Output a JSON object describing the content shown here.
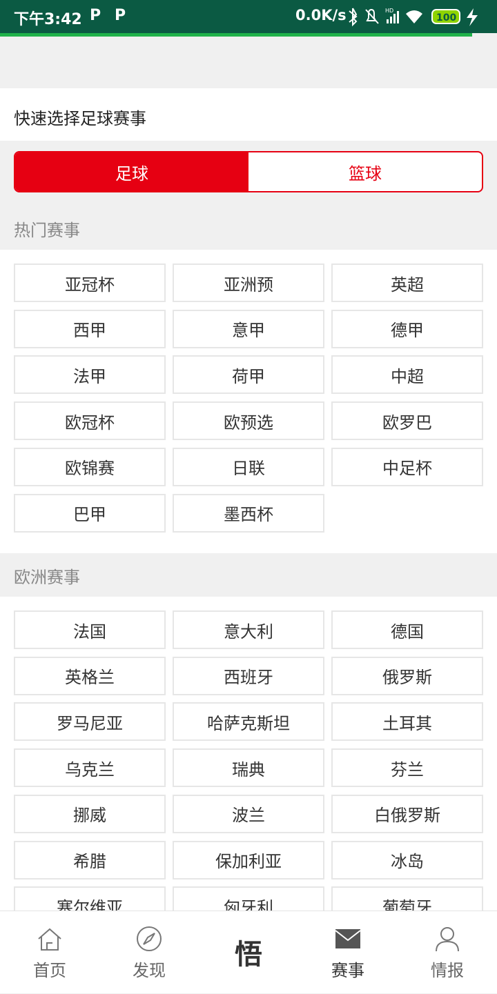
{
  "status": {
    "time": "下午3:42",
    "p1": "P",
    "p2": "P",
    "net": "0.0K/s",
    "battery": "100"
  },
  "header": {
    "title": "快速选择足球赛事"
  },
  "segment": {
    "left": "足球",
    "right": "篮球",
    "accent": "#e60012"
  },
  "sections": [
    {
      "title": "热门赛事",
      "items": [
        "亚冠杯",
        "亚洲预",
        "英超",
        "西甲",
        "意甲",
        "德甲",
        "法甲",
        "荷甲",
        "中超",
        "欧冠杯",
        "欧预选",
        "欧罗巴",
        "欧锦赛",
        "日联",
        "中足杯",
        "巴甲",
        "墨西杯"
      ]
    },
    {
      "title": "欧洲赛事",
      "items": [
        "法国",
        "意大利",
        "德国",
        "英格兰",
        "西班牙",
        "俄罗斯",
        "罗马尼亚",
        "哈萨克斯坦",
        "土耳其",
        "乌克兰",
        "瑞典",
        "芬兰",
        "挪威",
        "波兰",
        "白俄罗斯",
        "希腊",
        "保加利亚",
        "冰岛",
        "塞尔维亚",
        "匈牙利",
        "葡萄牙"
      ]
    }
  ],
  "tabs": [
    {
      "label": "首页",
      "icon": "home-icon"
    },
    {
      "label": "发现",
      "icon": "compass-icon"
    },
    {
      "label": "悟",
      "icon": ""
    },
    {
      "label": "赛事",
      "icon": "envelope-icon"
    },
    {
      "label": "情报",
      "icon": "user-icon"
    }
  ]
}
